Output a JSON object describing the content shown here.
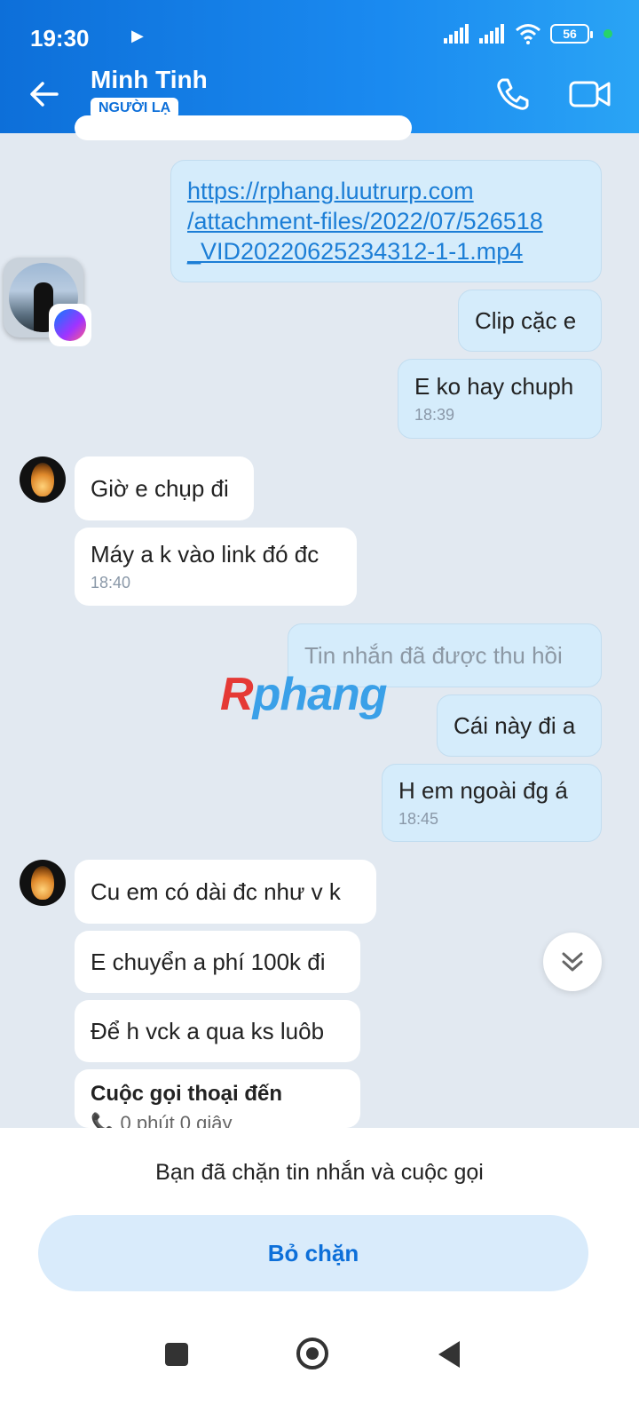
{
  "status_bar": {
    "time": "19:30",
    "battery": "56"
  },
  "header": {
    "name": "Minh Tinh",
    "tag": "NGƯỜI LẠ"
  },
  "messages": {
    "link": [
      "https://rphang.luutrurp.com",
      "/attachment-files/2022/07/526518",
      "_VID20220625234312-1-1.mp4"
    ],
    "m1": "Clip cặc e",
    "m2": "E ko hay chuph",
    "m2_time": "18:39",
    "m3": "Giờ e chụp đi",
    "m4": "Máy a k vào link đó đc",
    "m4_time": "18:40",
    "m5": "Tin nhắn đã được thu hồi",
    "m6": "Cái này đi a",
    "m7": "H em ngoài đg á",
    "m7_time": "18:45",
    "m8": "Cu em có dài đc như v k",
    "m9": "E chuyển a phí 100k đi",
    "m10": "Để h vck a qua ks luôb",
    "call_title": "Cuộc gọi thoại đến",
    "call_duration": "0 phút 0 giây"
  },
  "watermark": {
    "r": "R",
    "rest": "phang"
  },
  "footer": {
    "blocked_text": "Bạn đã chặn tin nhắn và cuộc gọi",
    "unblock_label": "Bỏ chặn"
  },
  "colors": {
    "header_start": "#0d6fd9",
    "header_end": "#2aa4f5",
    "sent_bubble": "#d5ecfb",
    "link": "#1c7ed6"
  }
}
